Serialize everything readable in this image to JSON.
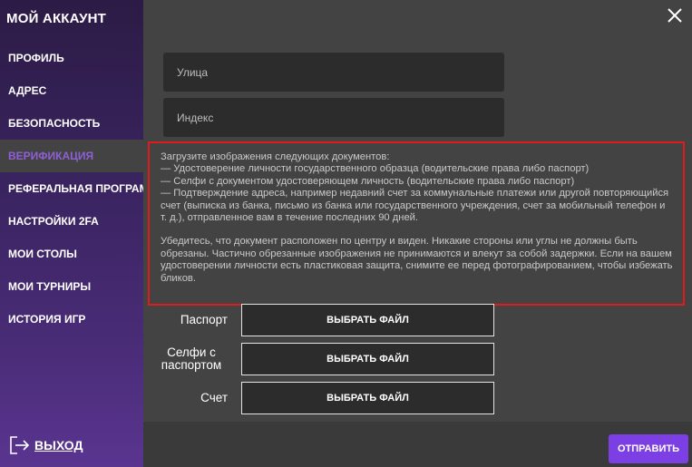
{
  "sidebar": {
    "title": "МОЙ АККАУНТ",
    "items": [
      {
        "label": "ПРОФИЛЬ",
        "active": false
      },
      {
        "label": "АДРЕС",
        "active": false
      },
      {
        "label": "БЕЗОПАСНОСТЬ",
        "active": false
      },
      {
        "label": "ВЕРИФИКАЦИЯ",
        "active": true
      },
      {
        "label": "РЕФЕРАЛЬНАЯ ПРОГРАММА",
        "active": false
      },
      {
        "label": "НАСТРОЙКИ 2FA",
        "active": false
      },
      {
        "label": "МОИ СТОЛЫ",
        "active": false
      },
      {
        "label": "МОИ ТУРНИРЫ",
        "active": false
      },
      {
        "label": "ИСТОРИЯ ИГР",
        "active": false
      }
    ],
    "logout_label": "ВЫХОД",
    "active_color": "#8e5fd6"
  },
  "form": {
    "street_placeholder": "Улица",
    "street_value": "",
    "zip_placeholder": "Индекс",
    "zip_value": ""
  },
  "info": {
    "lines": [
      "Загрузите изображения следующих документов:",
      "— Удостоверение личности государственного образца (водительские права либо паспорт)",
      "— Селфи с документом удостоверяющем личность (водительские права либо паспорт)",
      "— Подтверждение адреса, например недавний счет за коммунальные платежи или другой повторяющийся",
      "счет (выписка из банка, письмо из банка или государственного учреждения, счет за мобильный телефон и",
      "т. д.), отправленное вам в течение последних 90 дней.",
      "Убедитесь, что документ расположен по центру и виден. Никакие стороны или углы не должны быть",
      "обрезаны. Частично обрезанные изображения не принимаются и влекут за собой задержки. Если на вашем",
      "удостоверении личности есть пластиковая защита, снимите ее перед фотографированием, чтобы избежать",
      "бликов."
    ],
    "border_color": "#e01b1b"
  },
  "uploads": [
    {
      "label": "Паспорт",
      "button": "ВЫБРАТЬ ФАЙЛ"
    },
    {
      "label": "Селфи с паспортом",
      "button": "ВЫБРАТЬ ФАЙЛ"
    },
    {
      "label": "Счет",
      "button": "ВЫБРАТЬ ФАЙЛ"
    }
  ],
  "submit_label": "ОТПРАВИТЬ",
  "accent_color": "#7b3fe4",
  "icons": {
    "close": "close-icon",
    "logout": "logout-icon"
  }
}
